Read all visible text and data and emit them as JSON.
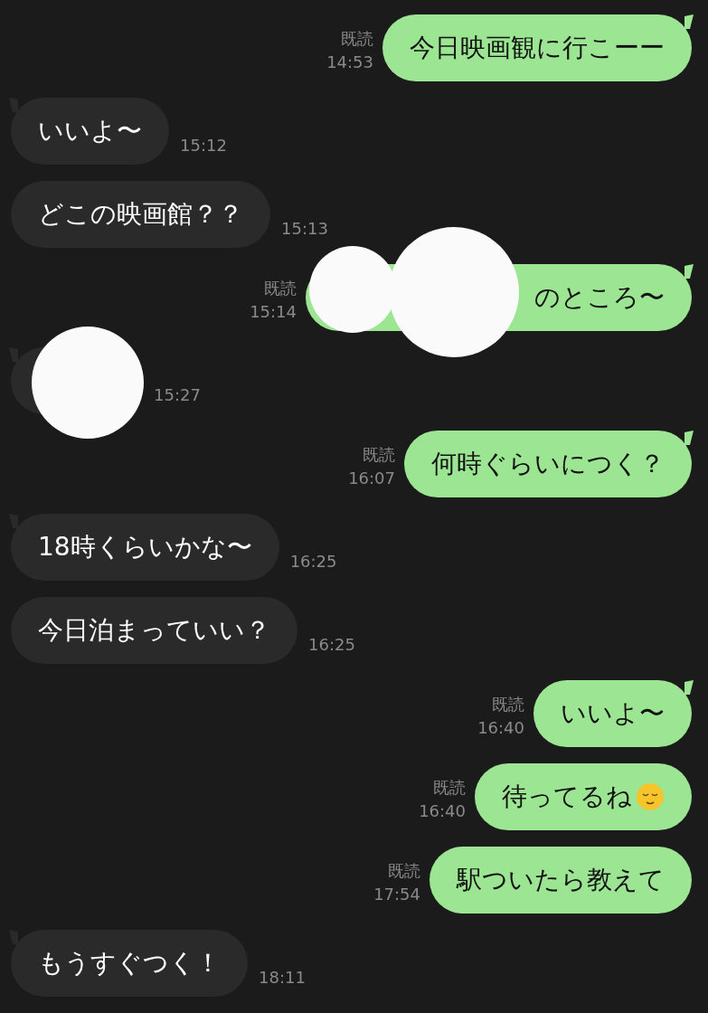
{
  "messages": [
    {
      "outgoing": true,
      "kind": "text",
      "tail": true,
      "read": "既読",
      "time": "14:53",
      "text": "今日映画観に行こーー"
    },
    {
      "outgoing": false,
      "kind": "text",
      "tail": true,
      "time": "15:12",
      "text": "いいよ〜"
    },
    {
      "outgoing": false,
      "kind": "text",
      "tail": false,
      "time": "15:13",
      "text": "どこの映画館？？"
    },
    {
      "outgoing": true,
      "kind": "redacted",
      "tail": true,
      "read": "既読",
      "time": "15:14",
      "text": "のところ〜"
    },
    {
      "outgoing": false,
      "kind": "redacted",
      "tail": true,
      "time": "15:27"
    },
    {
      "outgoing": true,
      "kind": "text",
      "tail": true,
      "read": "既読",
      "time": "16:07",
      "text": "何時ぐらいにつく？"
    },
    {
      "outgoing": false,
      "kind": "text",
      "tail": true,
      "time": "16:25",
      "text": "18時くらいかな〜"
    },
    {
      "outgoing": false,
      "kind": "text",
      "tail": false,
      "time": "16:25",
      "text": "今日泊まっていい？"
    },
    {
      "outgoing": true,
      "kind": "text",
      "tail": true,
      "read": "既読",
      "time": "16:40",
      "text": "いいよ〜"
    },
    {
      "outgoing": true,
      "kind": "emoji",
      "tail": false,
      "read": "既読",
      "time": "16:40",
      "text": "待ってるね"
    },
    {
      "outgoing": true,
      "kind": "text",
      "tail": false,
      "read": "既読",
      "time": "17:54",
      "text": "駅ついたら教えて"
    },
    {
      "outgoing": false,
      "kind": "text",
      "tail": true,
      "time": "18:11",
      "text": "もうすぐつく！"
    }
  ]
}
